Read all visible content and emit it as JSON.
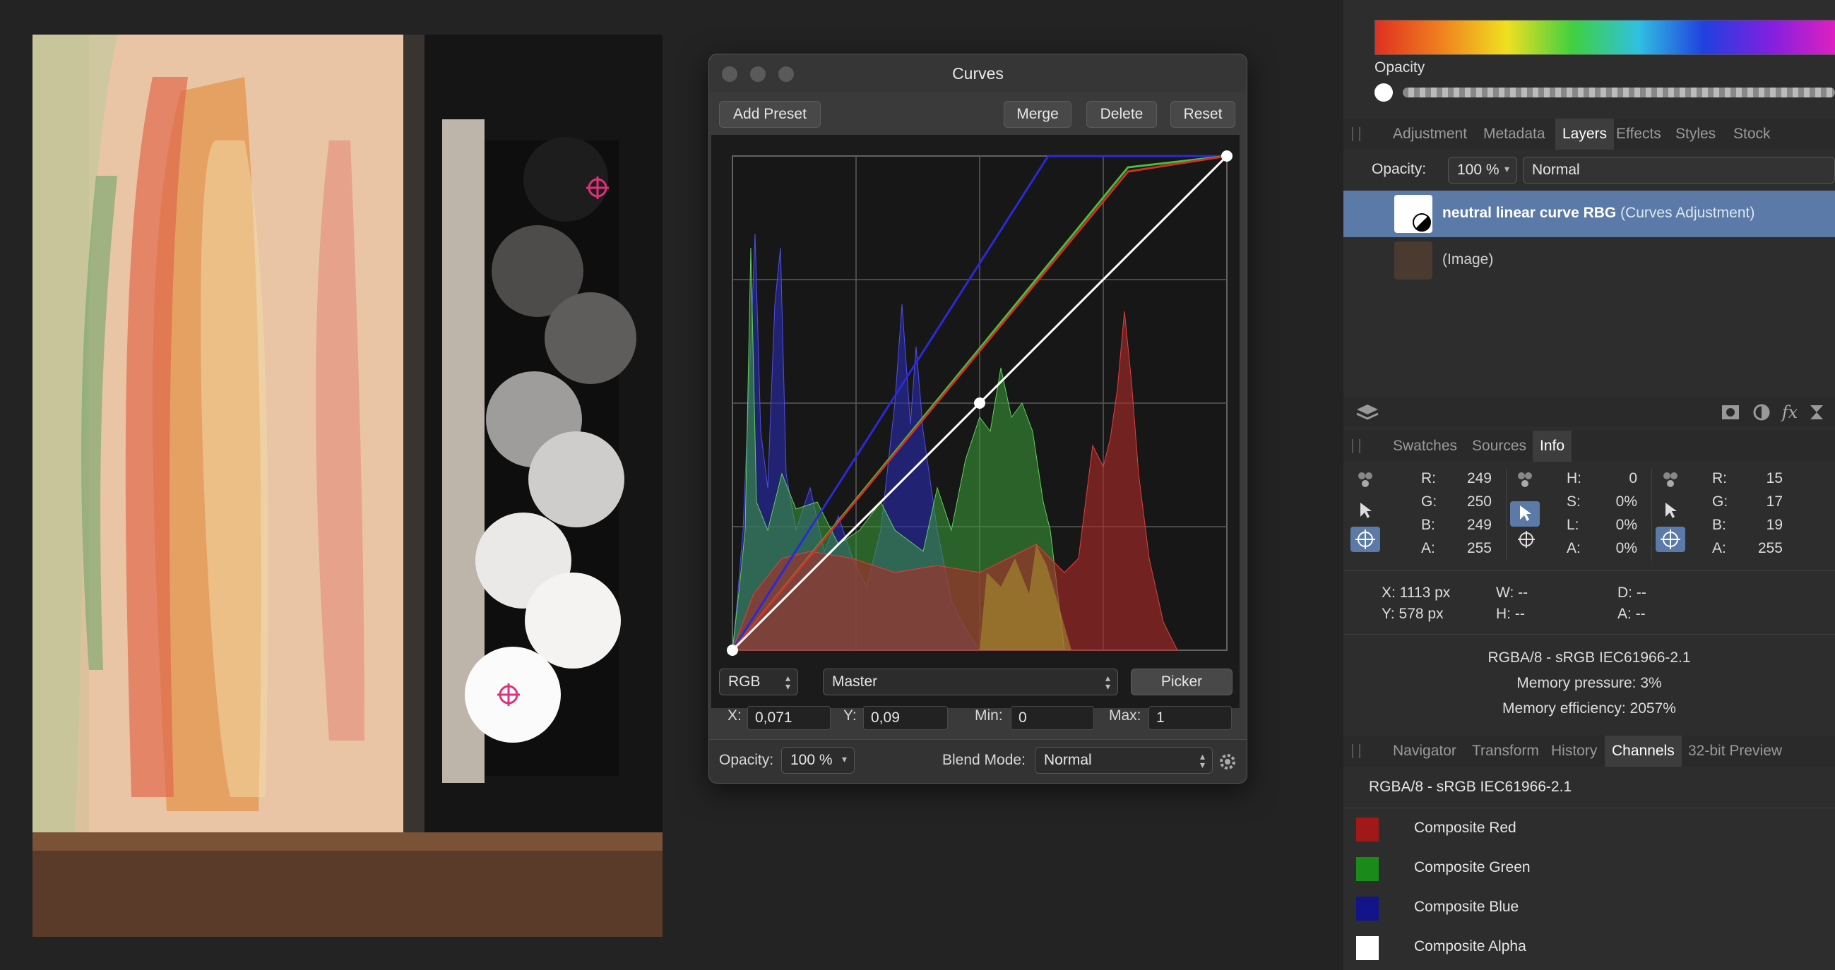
{
  "curves_dialog": {
    "title": "Curves",
    "buttons": {
      "add_preset": "Add Preset",
      "merge": "Merge",
      "delete": "Delete",
      "reset": "Reset",
      "picker": "Picker"
    },
    "color_space": "RGB",
    "channel": "Master",
    "x_label": "X:",
    "x_value": "0,071",
    "y_label": "Y:",
    "y_value": "0,09",
    "min_label": "Min:",
    "min_value": "0",
    "max_label": "Max:",
    "max_value": "1",
    "opacity_label": "Opacity:",
    "opacity_value": "100 %",
    "blend_label": "Blend Mode:",
    "blend_value": "Normal",
    "colors": {
      "red": "#d0302a",
      "green": "#48c03a",
      "blue": "#2a2ad8",
      "white": "#ffffff"
    }
  },
  "studio": {
    "color": {
      "opacity_label": "Opacity"
    },
    "tabs_top": [
      "Adjustment",
      "Metadata",
      "Layers",
      "Effects",
      "Styles",
      "Stock"
    ],
    "tabs_top_active": "Layers",
    "layers": {
      "opacity_label": "Opacity:",
      "opacity_value": "100 %",
      "blend_value": "Normal",
      "items": [
        {
          "name": "neutral linear curve RBG",
          "type": "(Curves Adjustment)"
        },
        {
          "name": "",
          "type": "(Image)"
        }
      ]
    },
    "tabs_mid": [
      "Swatches",
      "Sources",
      "Info"
    ],
    "tabs_mid_active": "Info",
    "info": {
      "col1": {
        "R": "249",
        "G": "250",
        "B": "249",
        "A": "255"
      },
      "col2": {
        "H": "0",
        "S": "0%",
        "L": "0%",
        "A": "0%"
      },
      "col3": {
        "R": "15",
        "G": "17",
        "B": "19",
        "A": "255"
      },
      "labels_rgba": [
        "R:",
        "G:",
        "B:",
        "A:"
      ],
      "labels_hsla": [
        "H:",
        "S:",
        "L:",
        "A:"
      ],
      "pos_x": "X: 1113 px",
      "pos_y": "Y: 578 px",
      "w": "W: --",
      "h": "H: --",
      "d": "D: --",
      "a": "A: --",
      "color_profile": "RGBA/8 - sRGB IEC61966-2.1",
      "memory_pressure": "Memory pressure: 3%",
      "memory_efficiency": "Memory efficiency: 2057%"
    },
    "tabs_bottom": [
      "Navigator",
      "Transform",
      "History",
      "Channels",
      "32-bit Preview"
    ],
    "tabs_bottom_active": "Channels",
    "channels": {
      "profile": "RGBA/8 - sRGB IEC61966-2.1",
      "items": [
        "Composite Red",
        "Composite Green",
        "Composite Blue",
        "Composite Alpha"
      ]
    }
  }
}
